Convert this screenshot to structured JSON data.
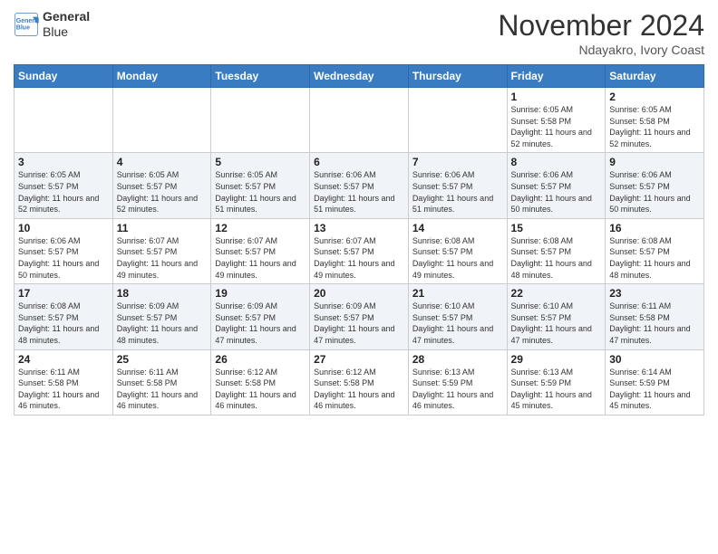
{
  "header": {
    "logo_line1": "General",
    "logo_line2": "Blue",
    "month": "November 2024",
    "location": "Ndayakro, Ivory Coast"
  },
  "days_of_week": [
    "Sunday",
    "Monday",
    "Tuesday",
    "Wednesday",
    "Thursday",
    "Friday",
    "Saturday"
  ],
  "weeks": [
    [
      {
        "day": "",
        "info": ""
      },
      {
        "day": "",
        "info": ""
      },
      {
        "day": "",
        "info": ""
      },
      {
        "day": "",
        "info": ""
      },
      {
        "day": "",
        "info": ""
      },
      {
        "day": "1",
        "info": "Sunrise: 6:05 AM\nSunset: 5:58 PM\nDaylight: 11 hours and 52 minutes."
      },
      {
        "day": "2",
        "info": "Sunrise: 6:05 AM\nSunset: 5:58 PM\nDaylight: 11 hours and 52 minutes."
      }
    ],
    [
      {
        "day": "3",
        "info": "Sunrise: 6:05 AM\nSunset: 5:57 PM\nDaylight: 11 hours and 52 minutes."
      },
      {
        "day": "4",
        "info": "Sunrise: 6:05 AM\nSunset: 5:57 PM\nDaylight: 11 hours and 52 minutes."
      },
      {
        "day": "5",
        "info": "Sunrise: 6:05 AM\nSunset: 5:57 PM\nDaylight: 11 hours and 51 minutes."
      },
      {
        "day": "6",
        "info": "Sunrise: 6:06 AM\nSunset: 5:57 PM\nDaylight: 11 hours and 51 minutes."
      },
      {
        "day": "7",
        "info": "Sunrise: 6:06 AM\nSunset: 5:57 PM\nDaylight: 11 hours and 51 minutes."
      },
      {
        "day": "8",
        "info": "Sunrise: 6:06 AM\nSunset: 5:57 PM\nDaylight: 11 hours and 50 minutes."
      },
      {
        "day": "9",
        "info": "Sunrise: 6:06 AM\nSunset: 5:57 PM\nDaylight: 11 hours and 50 minutes."
      }
    ],
    [
      {
        "day": "10",
        "info": "Sunrise: 6:06 AM\nSunset: 5:57 PM\nDaylight: 11 hours and 50 minutes."
      },
      {
        "day": "11",
        "info": "Sunrise: 6:07 AM\nSunset: 5:57 PM\nDaylight: 11 hours and 49 minutes."
      },
      {
        "day": "12",
        "info": "Sunrise: 6:07 AM\nSunset: 5:57 PM\nDaylight: 11 hours and 49 minutes."
      },
      {
        "day": "13",
        "info": "Sunrise: 6:07 AM\nSunset: 5:57 PM\nDaylight: 11 hours and 49 minutes."
      },
      {
        "day": "14",
        "info": "Sunrise: 6:08 AM\nSunset: 5:57 PM\nDaylight: 11 hours and 49 minutes."
      },
      {
        "day": "15",
        "info": "Sunrise: 6:08 AM\nSunset: 5:57 PM\nDaylight: 11 hours and 48 minutes."
      },
      {
        "day": "16",
        "info": "Sunrise: 6:08 AM\nSunset: 5:57 PM\nDaylight: 11 hours and 48 minutes."
      }
    ],
    [
      {
        "day": "17",
        "info": "Sunrise: 6:08 AM\nSunset: 5:57 PM\nDaylight: 11 hours and 48 minutes."
      },
      {
        "day": "18",
        "info": "Sunrise: 6:09 AM\nSunset: 5:57 PM\nDaylight: 11 hours and 48 minutes."
      },
      {
        "day": "19",
        "info": "Sunrise: 6:09 AM\nSunset: 5:57 PM\nDaylight: 11 hours and 47 minutes."
      },
      {
        "day": "20",
        "info": "Sunrise: 6:09 AM\nSunset: 5:57 PM\nDaylight: 11 hours and 47 minutes."
      },
      {
        "day": "21",
        "info": "Sunrise: 6:10 AM\nSunset: 5:57 PM\nDaylight: 11 hours and 47 minutes."
      },
      {
        "day": "22",
        "info": "Sunrise: 6:10 AM\nSunset: 5:57 PM\nDaylight: 11 hours and 47 minutes."
      },
      {
        "day": "23",
        "info": "Sunrise: 6:11 AM\nSunset: 5:58 PM\nDaylight: 11 hours and 47 minutes."
      }
    ],
    [
      {
        "day": "24",
        "info": "Sunrise: 6:11 AM\nSunset: 5:58 PM\nDaylight: 11 hours and 46 minutes."
      },
      {
        "day": "25",
        "info": "Sunrise: 6:11 AM\nSunset: 5:58 PM\nDaylight: 11 hours and 46 minutes."
      },
      {
        "day": "26",
        "info": "Sunrise: 6:12 AM\nSunset: 5:58 PM\nDaylight: 11 hours and 46 minutes."
      },
      {
        "day": "27",
        "info": "Sunrise: 6:12 AM\nSunset: 5:58 PM\nDaylight: 11 hours and 46 minutes."
      },
      {
        "day": "28",
        "info": "Sunrise: 6:13 AM\nSunset: 5:59 PM\nDaylight: 11 hours and 46 minutes."
      },
      {
        "day": "29",
        "info": "Sunrise: 6:13 AM\nSunset: 5:59 PM\nDaylight: 11 hours and 45 minutes."
      },
      {
        "day": "30",
        "info": "Sunrise: 6:14 AM\nSunset: 5:59 PM\nDaylight: 11 hours and 45 minutes."
      }
    ]
  ]
}
